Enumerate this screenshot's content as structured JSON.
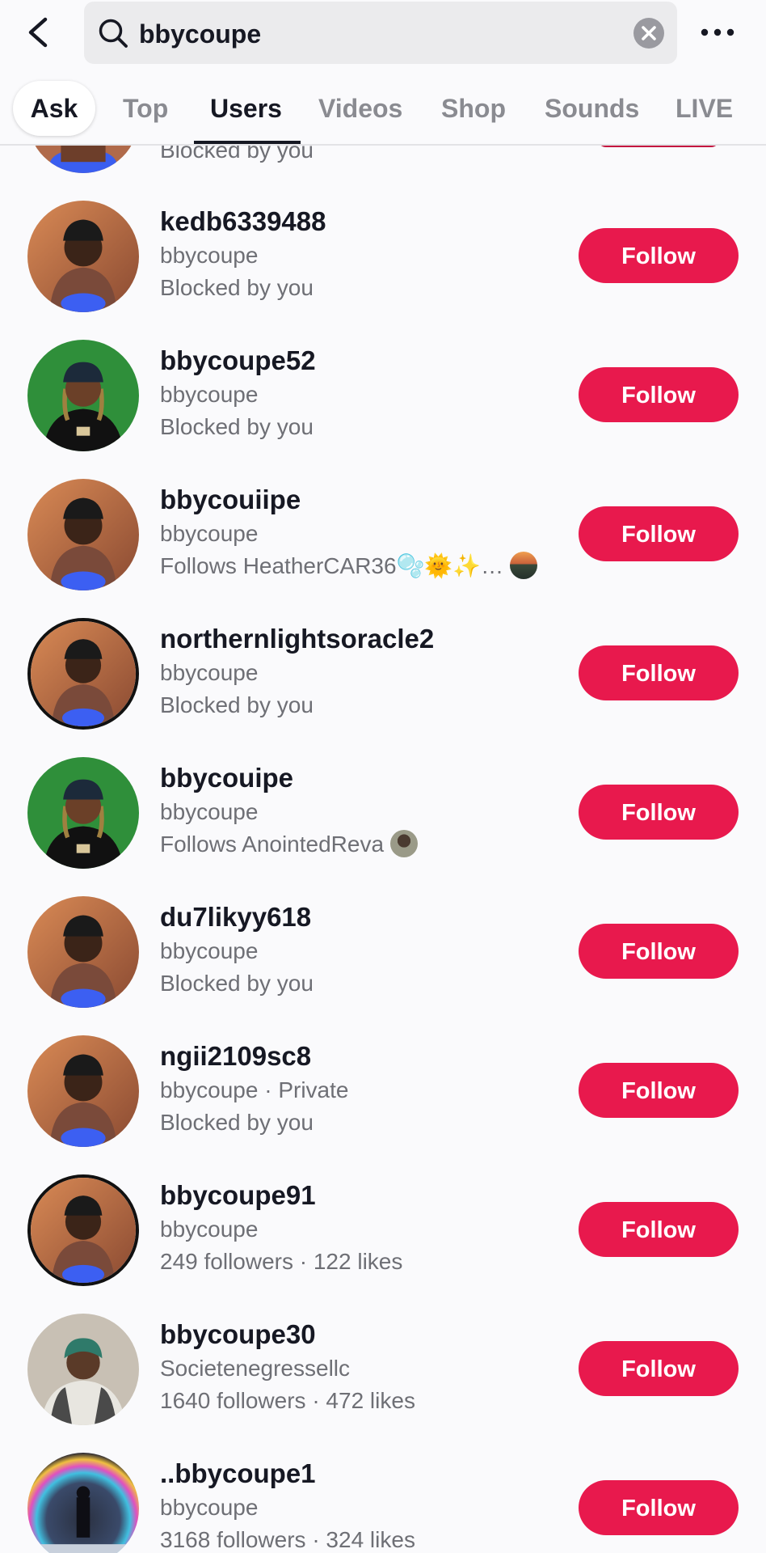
{
  "search": {
    "query": "bbycoupe"
  },
  "tabs": [
    {
      "label": "Ask"
    },
    {
      "label": "Top"
    },
    {
      "label": "Users"
    },
    {
      "label": "Videos"
    },
    {
      "label": "Shop"
    },
    {
      "label": "Sounds"
    },
    {
      "label": "LIVE"
    }
  ],
  "active_tab": "Users",
  "follow_label": "Follow",
  "partial_row": {
    "sub2": "Blocked by you"
  },
  "users": [
    {
      "username": "kedb6339488",
      "sub1": "bbycoupe",
      "sub2": "Blocked by you",
      "avatar": "man-beanie-orange-bg"
    },
    {
      "username": "bbycoupe52",
      "sub1": "bbycoupe",
      "sub2": "Blocked by you",
      "avatar": "man-locs-green-bg"
    },
    {
      "username": "bbycouiipe",
      "sub1": "bbycoupe",
      "sub2": "Follows HeatherCAR36🫧🌞✨…",
      "avatar": "man-beanie-orange-bg",
      "mutual_avatar": "landscape-thumb"
    },
    {
      "username": "northernlightsoracle2",
      "sub1": "bbycoupe",
      "sub2": "Blocked by you",
      "avatar": "man-beanie-orange-bg"
    },
    {
      "username": "bbycouipe",
      "sub1": "bbycoupe",
      "sub2": "Follows AnointedReva",
      "avatar": "man-locs-green-bg",
      "mutual_avatar": "person-thumb"
    },
    {
      "username": "du7likyy618",
      "sub1": "bbycoupe",
      "sub2": "Blocked by you",
      "avatar": "man-beanie-orange-bg"
    },
    {
      "username": "ngii2109sc8",
      "sub1": "bbycoupe · Private",
      "sub2": "Blocked by you",
      "avatar": "man-beanie-orange-bg"
    },
    {
      "username": "bbycoupe91",
      "sub1": "bbycoupe",
      "sub2": "249 followers · 122 likes",
      "avatar": "man-beanie-orange-bg"
    },
    {
      "username": "bbycoupe30",
      "sub1": "Societenegressellc",
      "sub2": "1640 followers · 472 likes",
      "avatar": "woman-headwrap"
    },
    {
      "username": "..bbycoupe1",
      "sub1": "bbycoupe",
      "sub2": "3168 followers · 324 likes",
      "avatar": "rainbow-figure"
    }
  ],
  "colors": {
    "accent": "#e8194d",
    "text_primary": "#161823",
    "text_secondary": "#6e6f75",
    "background": "#fafafc"
  }
}
